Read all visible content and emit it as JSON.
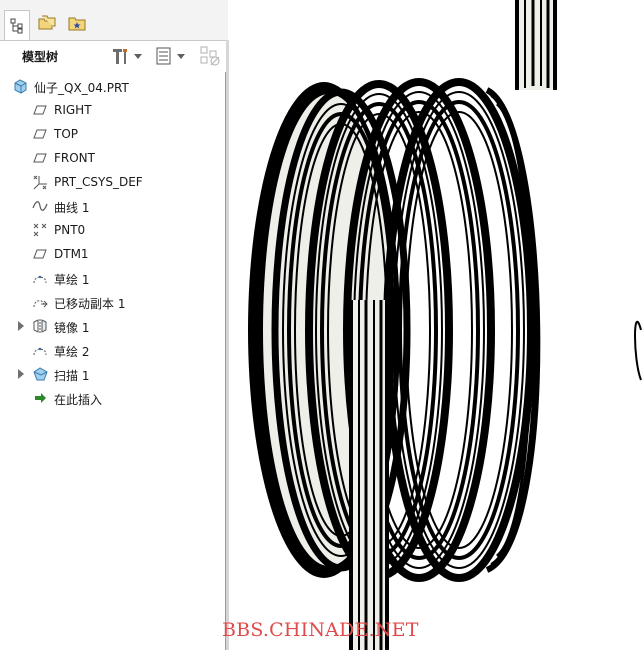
{
  "panel": {
    "tabs": [
      {
        "name": "model-tree-tab",
        "icon": "tree-icon",
        "active": true
      },
      {
        "name": "folder-browser-tab",
        "icon": "folders-icon",
        "active": false
      },
      {
        "name": "favorites-tab",
        "icon": "favorites-icon",
        "active": false
      }
    ],
    "title": "模型树",
    "tools": [
      "settings-icon",
      "show-icon",
      "filter-icon"
    ]
  },
  "tree": {
    "items": [
      {
        "label": "仙子_QX_04.PRT",
        "icon": "part-icon",
        "expandable": false
      },
      {
        "label": "RIGHT",
        "icon": "datum-plane-icon",
        "expandable": false
      },
      {
        "label": "TOP",
        "icon": "datum-plane-icon",
        "expandable": false
      },
      {
        "label": "FRONT",
        "icon": "datum-plane-icon",
        "expandable": false
      },
      {
        "label": "PRT_CSYS_DEF",
        "icon": "coordinate-system-icon",
        "expandable": false
      },
      {
        "label": "曲线 1",
        "icon": "curve-icon",
        "expandable": false
      },
      {
        "label": "PNT0",
        "icon": "datum-point-icon",
        "expandable": false
      },
      {
        "label": "DTM1",
        "icon": "datum-plane-icon",
        "expandable": false
      },
      {
        "label": "草绘 1",
        "icon": "sketch-icon",
        "expandable": false
      },
      {
        "label": "已移动副本 1",
        "icon": "moved-copy-icon",
        "expandable": false
      },
      {
        "label": "镜像 1",
        "icon": "mirror-icon",
        "expandable": true
      },
      {
        "label": "草绘 2",
        "icon": "sketch-icon",
        "expandable": false
      },
      {
        "label": "扫描 1",
        "icon": "sweep-icon",
        "expandable": true
      },
      {
        "label": "在此插入",
        "icon": "insert-here-icon",
        "expandable": false
      }
    ]
  },
  "watermark": "BBS.CHINADE.NET",
  "colors": {
    "wire_stroke": "#000000",
    "wire_fill": "#efefe9",
    "watermark": "#e04a4a",
    "tab_bar": "#f3f3f3",
    "insert_arrow": "#2a8a2a"
  }
}
